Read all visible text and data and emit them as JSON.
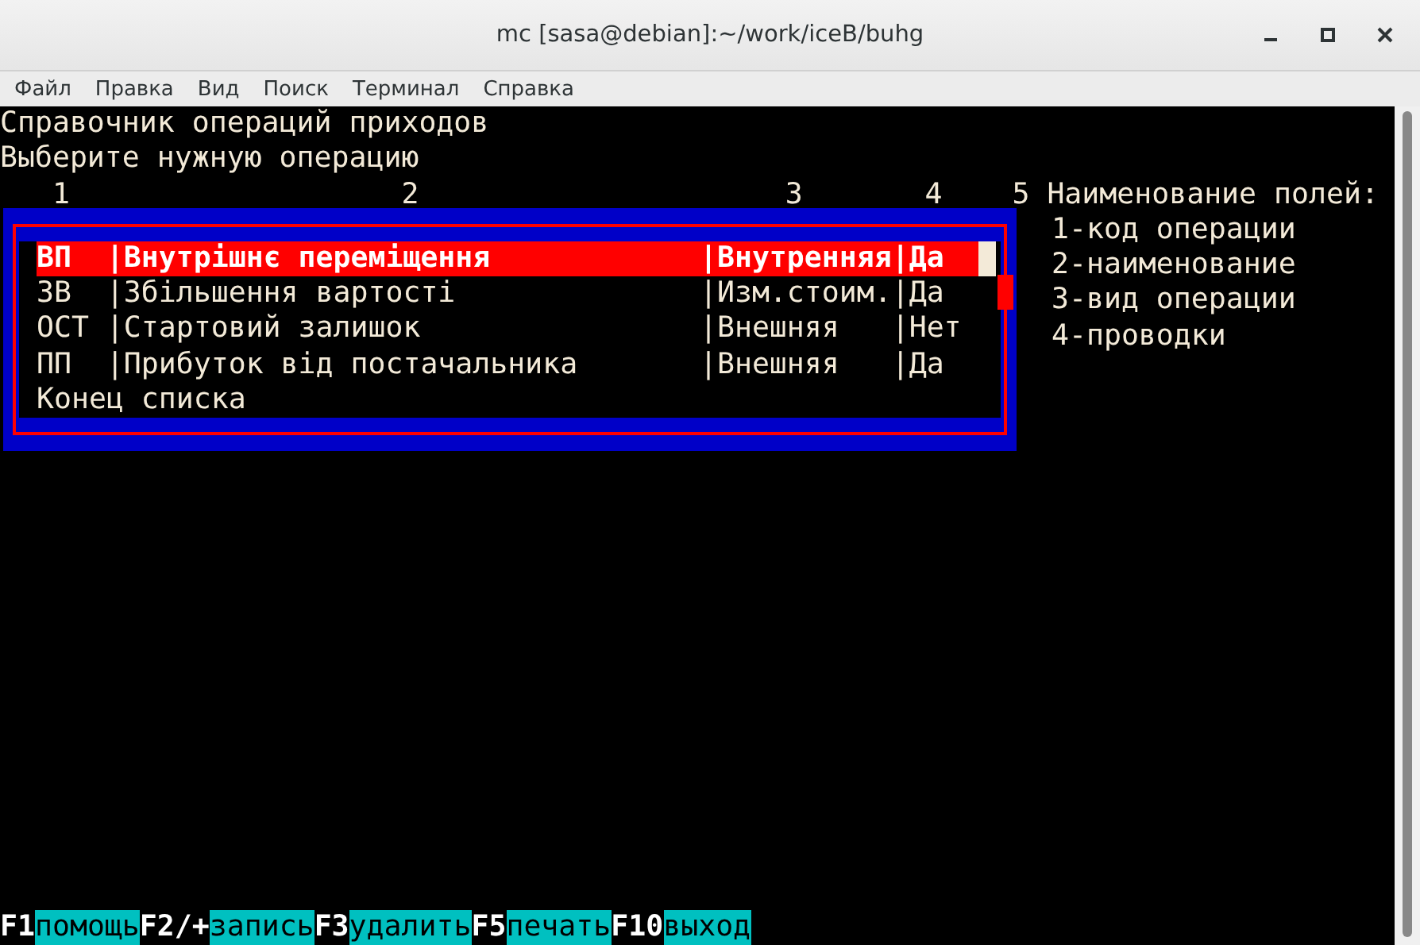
{
  "window": {
    "title": "mc [sasa@debian]:~/work/iceB/buhg"
  },
  "menu": [
    "Файл",
    "Правка",
    "Вид",
    "Поиск",
    "Терминал",
    "Справка"
  ],
  "terminal": {
    "lines": [
      "Справочник операций приходов",
      "Выберите нужную операцию"
    ],
    "column_numbers": [
      "1",
      "2",
      "3",
      "4",
      "5"
    ],
    "legend": {
      "title": "Наименование полей:",
      "items": [
        "1-код операции",
        "2-наименование",
        "3-вид операции",
        "4-проводки"
      ]
    },
    "table": {
      "separator": "|",
      "rows": [
        {
          "cells": [
            "ВП",
            "Внутрішнє переміщення",
            "Внутренняя",
            "Да"
          ],
          "selected": true
        },
        {
          "cells": [
            "ЗВ",
            "Збільшення вартості",
            "Изм.стоим.",
            "Да"
          ],
          "selected": false
        },
        {
          "cells": [
            "ОСТ",
            "Стартовий залишок",
            "Внешняя",
            "Нет"
          ],
          "selected": false
        },
        {
          "cells": [
            "ПП",
            "Прибуток від постачальника",
            "Внешняя",
            "Да"
          ],
          "selected": false
        }
      ],
      "footer": "Конец списка"
    },
    "function_keys": [
      {
        "key": "F1",
        "label": "помощь"
      },
      {
        "key": "F2/+",
        "label": "запись"
      },
      {
        "key": "F3",
        "label": "удалить"
      },
      {
        "key": "F5",
        "label": "печать"
      },
      {
        "key": "F10",
        "label": "выход"
      }
    ]
  }
}
